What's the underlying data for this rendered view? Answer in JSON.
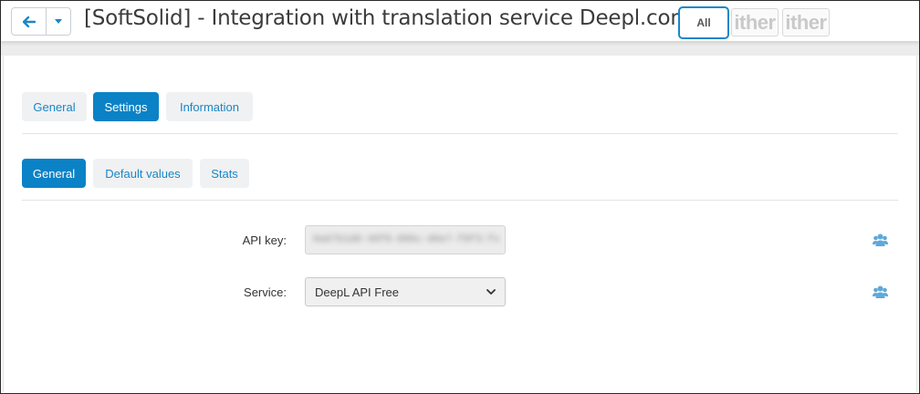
{
  "header": {
    "title": "[SoftSolid] - Integration with translation service Deepl.com",
    "all_label": "All",
    "logo_text": "ither"
  },
  "tabs": [
    {
      "label": "General",
      "active": false
    },
    {
      "label": "Settings",
      "active": true
    },
    {
      "label": "Information",
      "active": false
    }
  ],
  "subtabs": [
    {
      "label": "General",
      "active": true
    },
    {
      "label": "Default values",
      "active": false
    },
    {
      "label": "Stats",
      "active": false
    }
  ],
  "form": {
    "api_key_label": "API key:",
    "api_key_value": "0a07b1d0-40f0-886c-d6e7-f8f3:fx",
    "service_label": "Service:",
    "service_value": "DeepL API Free"
  },
  "colors": {
    "accent": "#0b82c6",
    "link": "#1a86c8",
    "tab_bg": "#f0f1f2",
    "icon": "#5ea9d8"
  },
  "icons": [
    "arrow-left-icon",
    "caret-down-icon",
    "chevron-down-icon",
    "users-icon"
  ]
}
